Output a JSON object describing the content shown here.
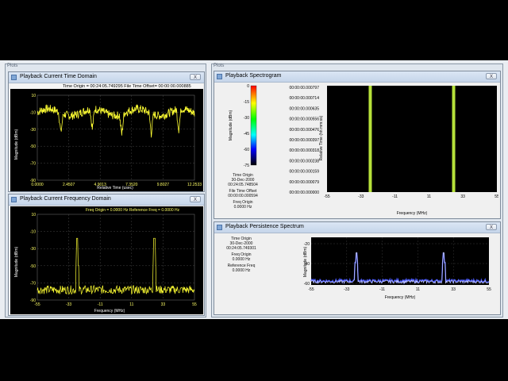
{
  "left_panel": {
    "title": "Plots"
  },
  "right_panel": {
    "title": "Plots"
  },
  "time_domain": {
    "title": "Playback Current Time Domain",
    "header": "Time Origin = 00:24:05.749295  File Time Offset= 00:00:00.000885",
    "ylabel": "Magnitude (dBm)",
    "xlabel": "Relative Time (usec)",
    "yticks": [
      "10",
      "-10",
      "-30",
      "-50",
      "-70",
      "-90"
    ],
    "xticks": [
      "0.0000",
      "2.4507",
      "4.9013",
      "7.3520",
      "9.8027",
      "12.2533"
    ],
    "trace_color": "#ffff33"
  },
  "freq_domain": {
    "title": "Playback Current Frequency Domain",
    "header": "Freq Origin = 0.0000 Hz   Reference Freq = 0.0000 Hz",
    "ylabel": "Magnitude (dBm)",
    "xlabel": "Frequency (MHz)",
    "yticks": [
      "10",
      "-10",
      "-30",
      "-50",
      "-70",
      "-90"
    ],
    "xticks": [
      "-55",
      "-33",
      "-11",
      "11",
      "33",
      "55"
    ],
    "peaks_mhz": [
      -27,
      27
    ],
    "trace_color": "#ffff33"
  },
  "spectrogram": {
    "title": "Playback Spectrogram",
    "colorbar_label": "Magnitude (dBm)",
    "colorbar_ticks": [
      "0",
      "-15",
      "-30",
      "-45",
      "-60",
      "-75"
    ],
    "ylabel": "Relative Time (hh:mm:ss)",
    "time_ticks": [
      "00:00:00.000797",
      "00:00:00.000714",
      "00:00:00.000635",
      "00:00:00.000556",
      "00:00:00.000476",
      "00:00:00.000397",
      "00:00:00.000318",
      "00:00:00.000238",
      "00:00:00.000159",
      "00:00:00.000079",
      "00:00:00.000000"
    ],
    "xlabel": "Frequency (MHz)",
    "xticks": [
      "-55",
      "-33",
      "-11",
      "11",
      "33",
      "55"
    ],
    "info": [
      "Time Origin",
      "30-Dec-2000",
      "00:24:05.748504",
      "File Time Offset",
      "00:00:00.000594",
      "Freq Origin",
      "0.0000 Hz"
    ],
    "lines_mhz": [
      -27,
      27
    ],
    "line_color": "#b6e13a"
  },
  "persistence": {
    "title": "Playback Persistence Spectrum",
    "info": [
      "Time Origin",
      "30-Dec-2000",
      "00:24:05.749301",
      "Freq Origin",
      "0.0000 Hz",
      "Reference Freq",
      "0.0000 Hz"
    ],
    "ylabel": "Magnitude (dBm)",
    "yticks": [
      "-20",
      "-40",
      "-60"
    ],
    "xticks": [
      "-55",
      "-33",
      "-11",
      "11",
      "33",
      "55"
    ],
    "xlabel": "Frequency (MHz)",
    "peaks_mhz": [
      -27,
      27
    ],
    "noise_color": "#4d5cff",
    "trace_color": "#ffffff"
  },
  "close_label": "X"
}
